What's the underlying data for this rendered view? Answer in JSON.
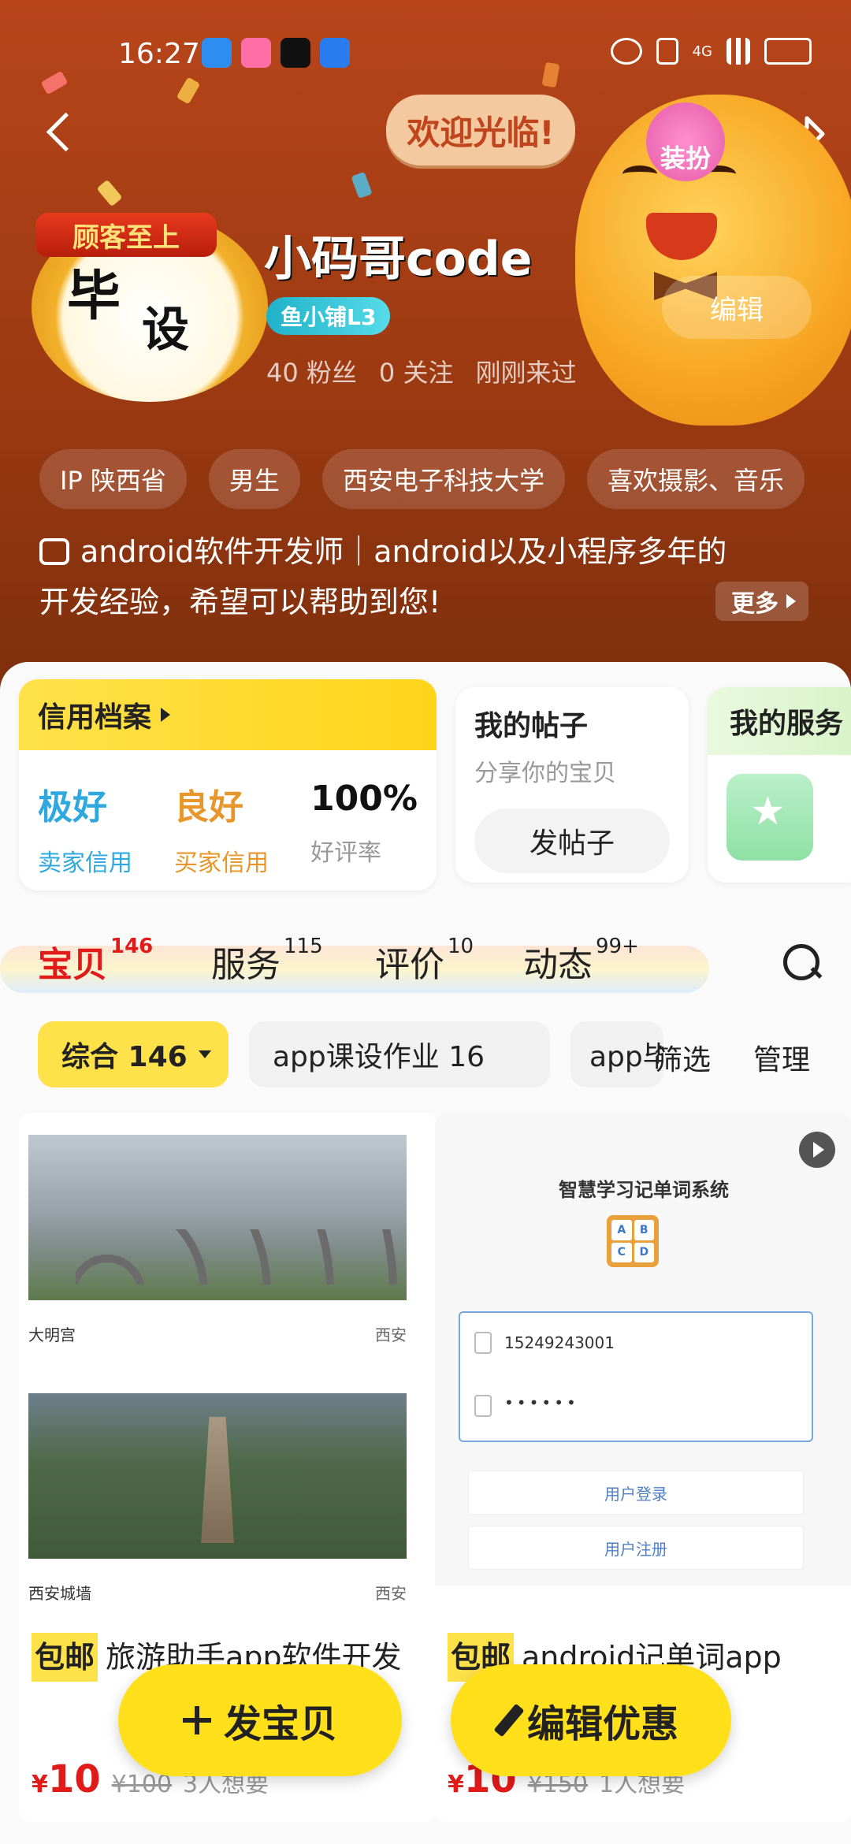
{
  "status_bar": {
    "time": "16:27",
    "network": "4G"
  },
  "header": {
    "welcome": "欢迎光临!",
    "dress_up": "装扮",
    "edit": "编辑",
    "avatar_banner": "顾客至上",
    "avatar_chars": "毕",
    "avatar_char_2": "设"
  },
  "profile": {
    "username": "小码哥code",
    "level": "鱼小铺L3",
    "fans": "40 粉丝",
    "following": "0 关注",
    "last_seen": "刚刚来过",
    "tags": [
      "IP 陕西省",
      "男生",
      "西安电子科技大学",
      "喜欢摄影、音乐"
    ],
    "bio_line1": "android软件开发师｜android以及小程序多年的",
    "bio_line2": "开发经验，希望可以帮助到您!",
    "more": "更多"
  },
  "credit": {
    "title": "信用档案",
    "items": [
      {
        "value": "极好",
        "label": "卖家信用",
        "color": "#2fa8e0"
      },
      {
        "value": "良好",
        "label": "买家信用",
        "color": "#e8962a"
      },
      {
        "value": "100%",
        "label": "好评率",
        "color": "#111111"
      }
    ]
  },
  "posts": {
    "title": "我的帖子",
    "subtitle": "分享你的宝贝",
    "button": "发帖子"
  },
  "services": {
    "title": "我的服务"
  },
  "tabs": [
    {
      "label": "宝贝",
      "count": "146"
    },
    {
      "label": "服务",
      "count": "115"
    },
    {
      "label": "评价",
      "count": "10"
    },
    {
      "label": "动态",
      "count": "99+"
    }
  ],
  "filters": {
    "active": "综合 146",
    "chip2": "app课设作业 16",
    "chip3": "app毕",
    "filter": "筛选",
    "manage": "管理"
  },
  "products": [
    {
      "photo1_caption_left": "大明宫",
      "photo1_caption_right": "西安",
      "photo2_caption_left": "西安城墙",
      "photo2_caption_right": "西安",
      "free_ship": "包邮",
      "title": "旅游助手app软件开发",
      "price": "10",
      "old_price": "¥100",
      "wants": "3人想要"
    },
    {
      "login_title": "智慧学习记单词系统",
      "letters": [
        "A",
        "B",
        "C",
        "D"
      ],
      "phone": "15249243001",
      "password": "••••••",
      "login_btn": "用户登录",
      "register_btn": "用户注册",
      "free_ship": "包邮",
      "title": "android记单词app",
      "price": "10",
      "old_price": "¥150",
      "wants": "1人想要"
    }
  ],
  "fab": {
    "publish": "发宝贝",
    "coupon": "编辑优惠"
  }
}
